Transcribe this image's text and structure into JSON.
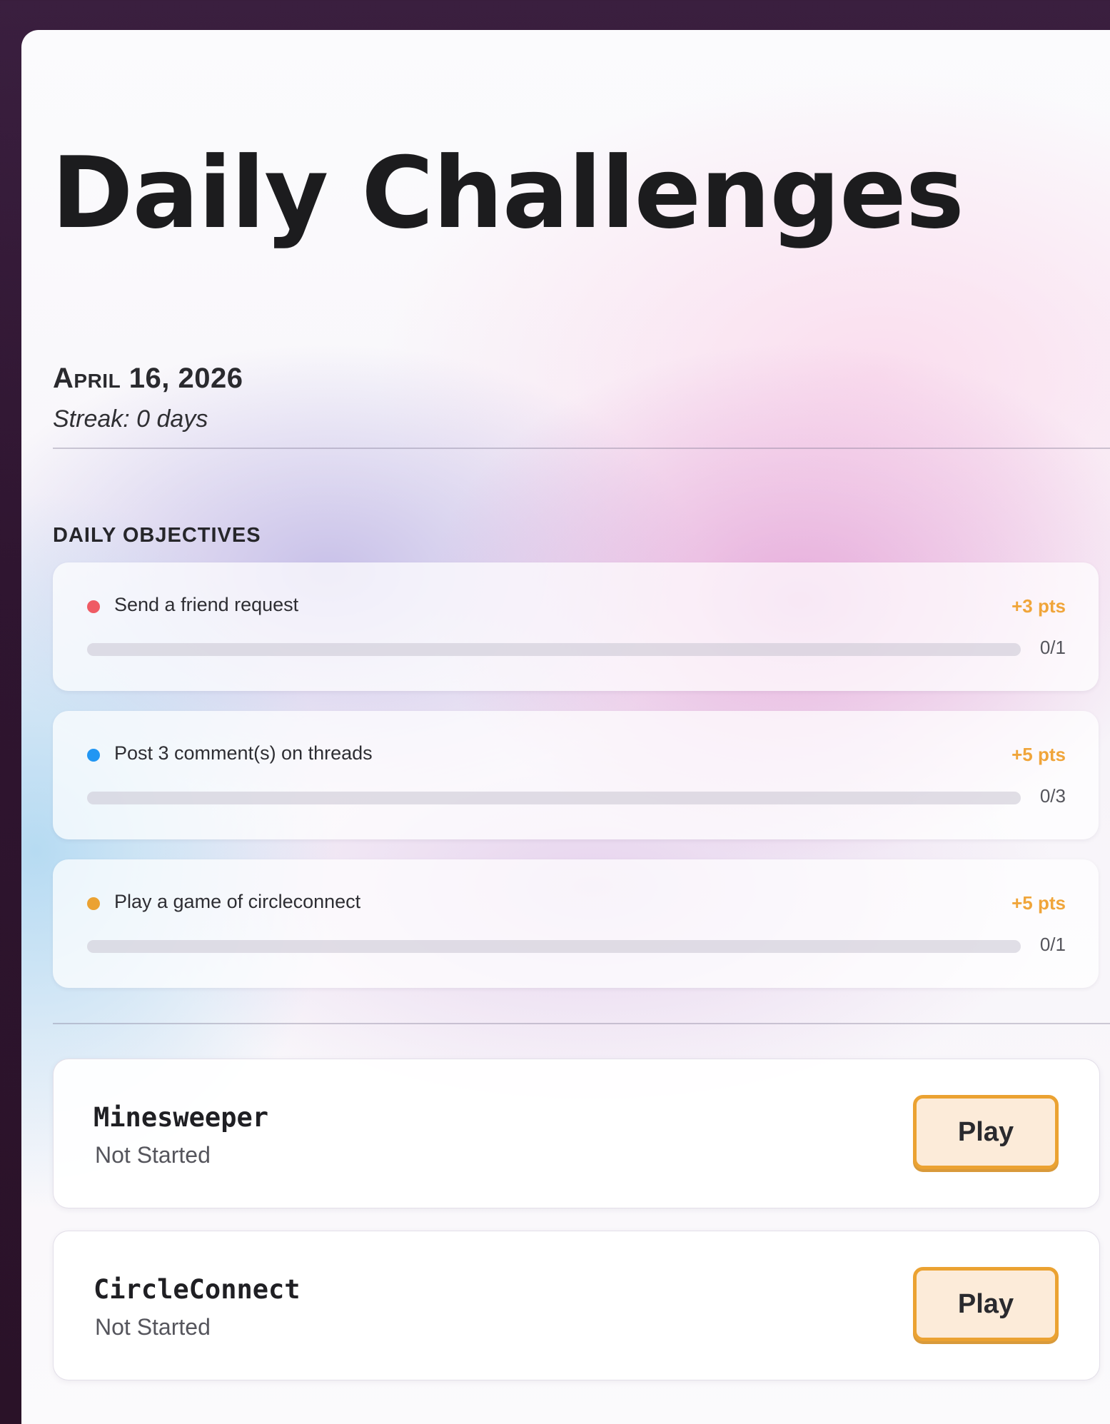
{
  "page": {
    "title": "Daily Challenges",
    "date": "April 16, 2026",
    "streak": "Streak: 0 days"
  },
  "objectives": {
    "heading": "DAILY OBJECTIVES",
    "items": [
      {
        "label": "Send a friend request",
        "points": "+3 pts",
        "progress_text": "0/1",
        "progress_fraction": 0,
        "dot_color": "#ef5b64"
      },
      {
        "label": "Post 3 comment(s) on threads",
        "points": "+5 pts",
        "progress_text": "0/3",
        "progress_fraction": 0,
        "dot_color": "#2196f3"
      },
      {
        "label": "Play a game of circleconnect",
        "points": "+5 pts",
        "progress_text": "0/1",
        "progress_fraction": 0,
        "dot_color": "#eba232"
      }
    ]
  },
  "games": [
    {
      "name": "Minesweeper",
      "status": "Not Started",
      "button_label": "Play"
    },
    {
      "name": "CircleConnect",
      "status": "Not Started",
      "button_label": "Play"
    }
  ],
  "colors": {
    "points_accent": "#f0a53a",
    "play_button_border": "#eba232",
    "play_button_bg": "#fcebd9",
    "frame_bg": "#3a1f3f"
  }
}
